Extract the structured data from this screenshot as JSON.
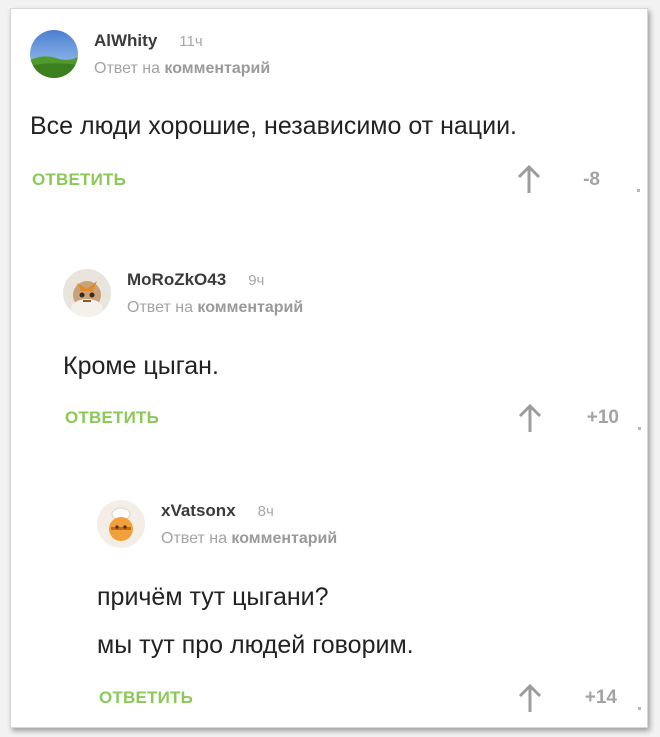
{
  "comments": [
    {
      "username": "AlWhity",
      "time": "11ч",
      "reply_prefix": "Ответ на",
      "reply_link": "комментарий",
      "text_lines": [
        "Все люди хорошие, независимо от нации."
      ],
      "reply_button": "ОТВЕТИТЬ",
      "rating": "-8"
    },
    {
      "username": "MoRoZkO43",
      "time": "9ч",
      "reply_prefix": "Ответ на",
      "reply_link": "комментарий",
      "text_lines": [
        "Кроме цыган."
      ],
      "reply_button": "ОТВЕТИТЬ",
      "rating": "+10"
    },
    {
      "username": "xVatsonx",
      "time": "8ч",
      "reply_prefix": "Ответ на",
      "reply_link": "комментарий",
      "text_lines": [
        "причём тут цыгани?",
        "мы тут про людей говорим."
      ],
      "reply_button": "ОТВЕТИТЬ",
      "rating": "+14"
    }
  ],
  "icons": {
    "vote_up": "arrow-up-icon",
    "more": "more-icon"
  },
  "colors": {
    "reply_button": "#8ac858",
    "muted_text": "#a3a3a3",
    "username": "#3a3a3a",
    "body_text": "#222222"
  }
}
